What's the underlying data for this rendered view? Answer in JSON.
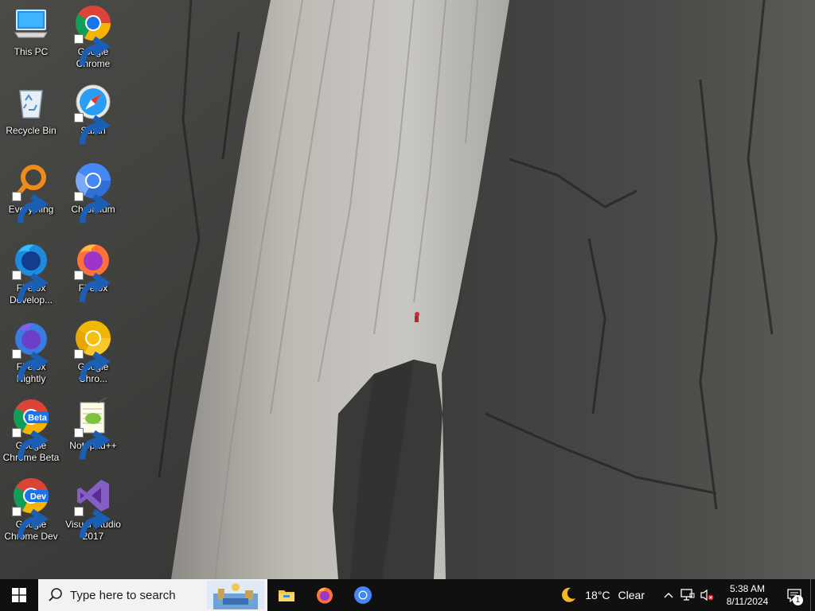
{
  "desktop": {
    "icons": [
      {
        "id": "this-pc",
        "label": "This PC",
        "icon": "this-pc-icon",
        "shortcut": false
      },
      {
        "id": "google-chrome",
        "label": "Google Chrome",
        "icon": "chrome-icon",
        "shortcut": true
      },
      {
        "id": "recycle-bin",
        "label": "Recycle Bin",
        "icon": "recycle-bin-icon",
        "shortcut": false
      },
      {
        "id": "safari",
        "label": "Safari",
        "icon": "safari-icon",
        "shortcut": true
      },
      {
        "id": "everything",
        "label": "Everything",
        "icon": "everything-icon",
        "shortcut": true
      },
      {
        "id": "chromium",
        "label": "Chromium",
        "icon": "chromium-icon",
        "shortcut": true
      },
      {
        "id": "firefox-developer",
        "label": "Firefox Develop...",
        "icon": "firefox-developer-icon",
        "shortcut": true
      },
      {
        "id": "firefox",
        "label": "Firefox",
        "icon": "firefox-icon",
        "shortcut": true
      },
      {
        "id": "firefox-nightly",
        "label": "Firefox Nightly",
        "icon": "firefox-nightly-icon",
        "shortcut": true
      },
      {
        "id": "google-chrome-canary",
        "label": "Google Chro...",
        "icon": "chrome-canary-icon",
        "shortcut": true
      },
      {
        "id": "google-chrome-beta",
        "label": "Google Chrome Beta",
        "icon": "chrome-beta-icon",
        "shortcut": true,
        "badge": "Beta"
      },
      {
        "id": "notepad-plus-plus",
        "label": "Notepad++",
        "icon": "notepad-plus-plus-icon",
        "shortcut": true
      },
      {
        "id": "google-chrome-dev",
        "label": "Google Chrome Dev",
        "icon": "chrome-dev-icon",
        "shortcut": true,
        "badge": "Dev"
      },
      {
        "id": "visual-studio-2017",
        "label": "Visual Studio 2017",
        "icon": "visual-studio-icon",
        "shortcut": true
      }
    ]
  },
  "taskbar": {
    "start_icon": "windows-logo-icon",
    "search": {
      "placeholder": "Type here to search",
      "icon": "search-icon"
    },
    "pinned": [
      {
        "id": "file-explorer",
        "icon": "file-explorer-icon"
      },
      {
        "id": "firefox",
        "icon": "firefox-icon"
      },
      {
        "id": "chromium",
        "icon": "chromium-icon"
      }
    ],
    "weather": {
      "icon": "moon-icon",
      "temperature": "18°C",
      "condition": "Clear"
    },
    "tray": {
      "icons": [
        "chevron-up-icon",
        "network-icon",
        "volume-muted-icon"
      ],
      "time": "5:38 AM",
      "date": "8/11/2024",
      "notification_count": "1"
    }
  },
  "colors": {
    "taskbar_bg": "#101010",
    "search_bg": "#f2f2f2",
    "chrome_blue": "#1a73e8",
    "chromium_blue": "#4587f4"
  }
}
